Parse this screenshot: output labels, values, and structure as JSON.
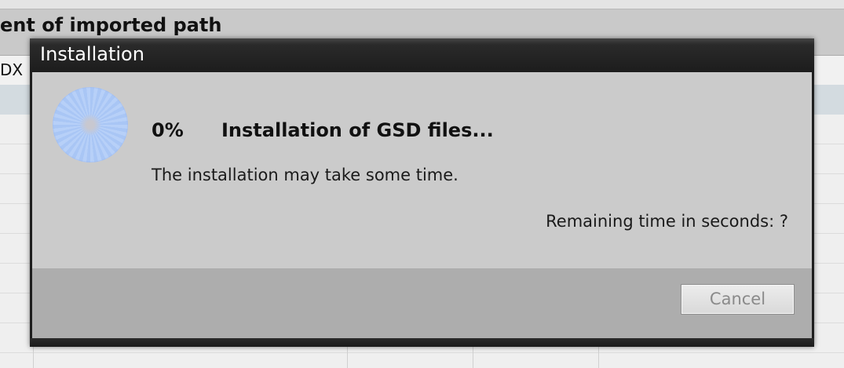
{
  "background": {
    "title_fragment": "ent of imported path",
    "column_header_fragment": "DX"
  },
  "dialog": {
    "title": "Installation",
    "progress_percent_text": "0%",
    "progress_value": 0,
    "task_title": "Installation of GSD files...",
    "info_text": "The installation may take some time.",
    "remaining_time_text": "Remaining time in seconds: ?",
    "cancel_label": "Cancel",
    "cancel_enabled": false,
    "spinner_icon": "busy-spinner-icon"
  },
  "colors": {
    "titlebar": "#1e1e1e",
    "body": "#cbcbcb",
    "footer": "#adadad",
    "spinner_blue": "#a9c6f5"
  }
}
